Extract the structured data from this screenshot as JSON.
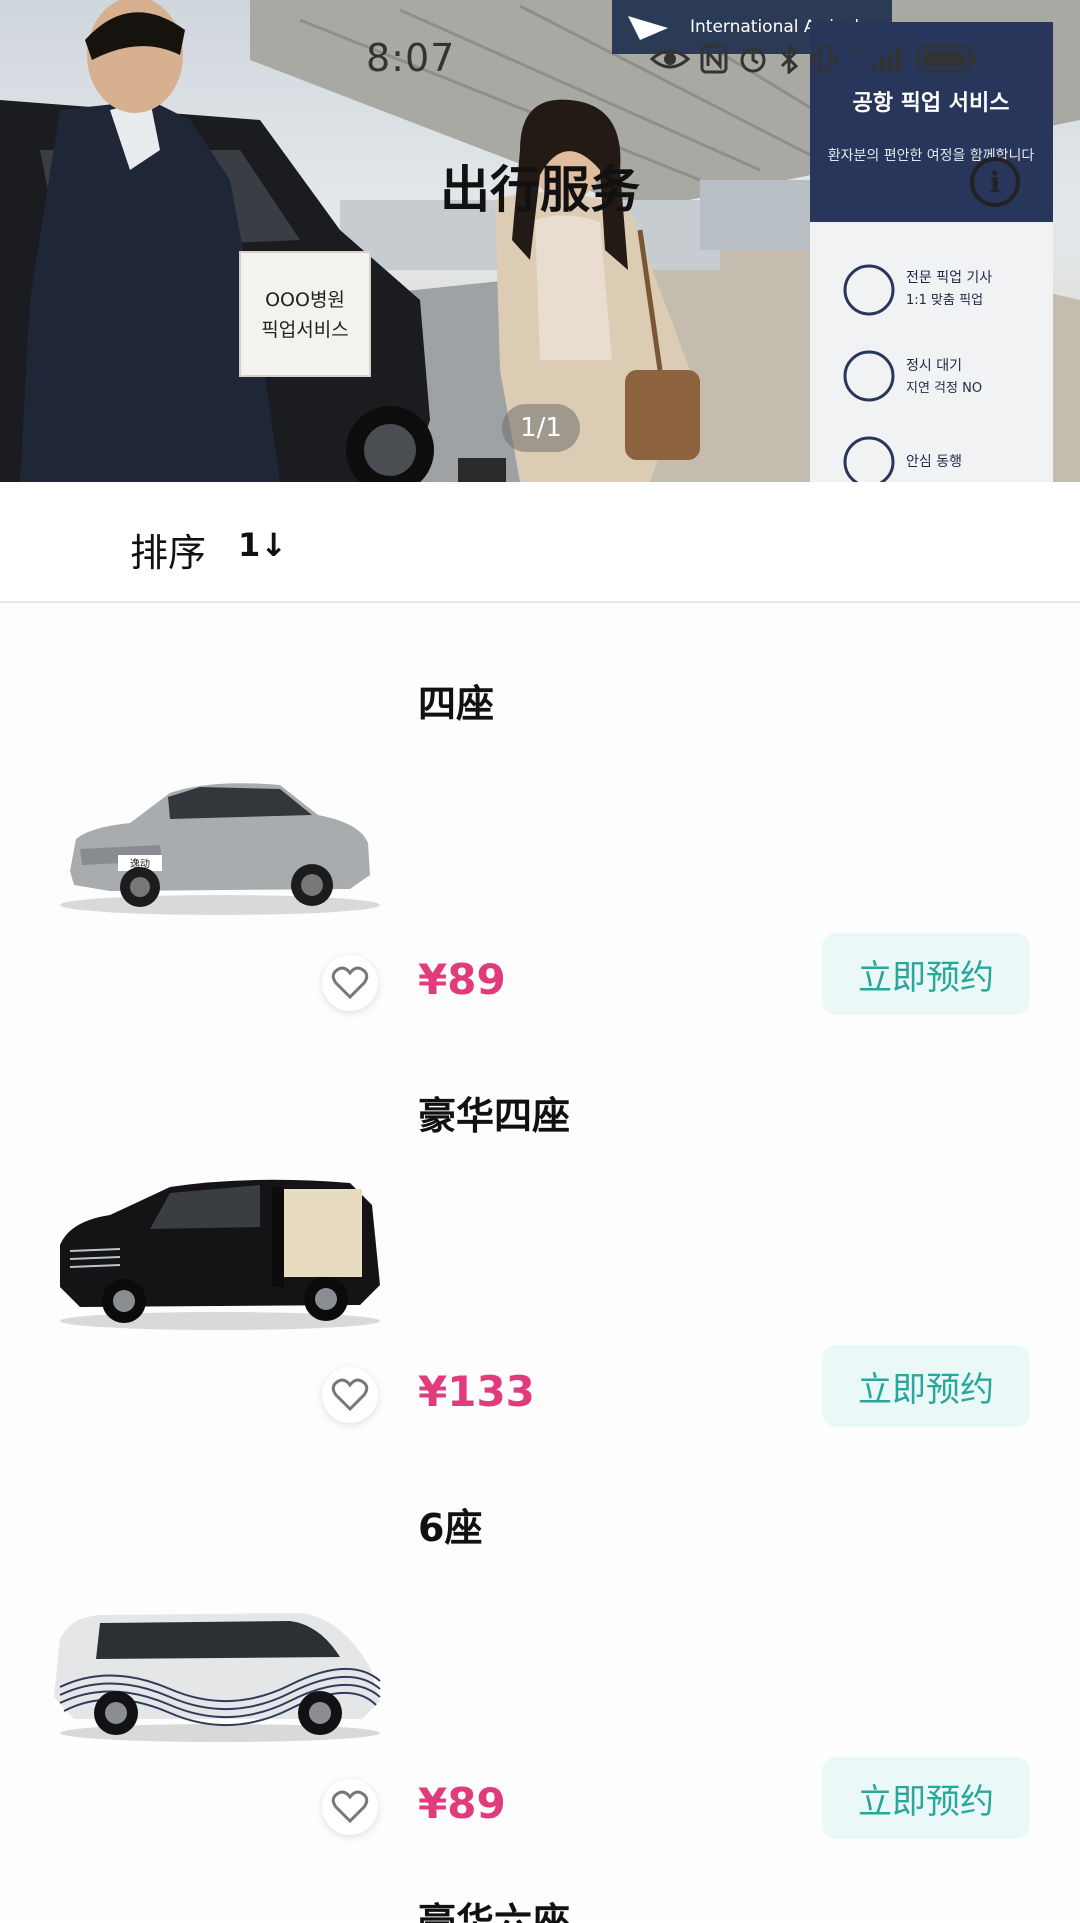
{
  "status_bar": {
    "time": "8:07",
    "icons": [
      "eye-icon",
      "nfc-icon",
      "alarm-icon",
      "bluetooth-icon",
      "vibrate-icon",
      "signal-5g-icon",
      "battery-icon"
    ]
  },
  "hero": {
    "title": "出行服务",
    "pager": "1/1",
    "photo_signs": {
      "arrivals": "International Arrivals",
      "board_title": "공항 픽업 서비스",
      "board_sub": "환자분의 편안한 여정을 함께합니다",
      "board_items": [
        "전문 픽업 기사",
        "1:1 맞춤 픽업",
        "정시 대기",
        "지연 걱정 NO",
        "안심 동행"
      ],
      "hand_sign_line1": "OOO병원",
      "hand_sign_line2": "픽업서비스"
    }
  },
  "sort": {
    "label": "排序",
    "icon_text": "1↓"
  },
  "cars": [
    {
      "title": "四座",
      "price": "¥89",
      "button": "立即预约",
      "plate": "逸动"
    },
    {
      "title": "豪华四座",
      "price": "¥133",
      "button": "立即预约"
    },
    {
      "title": "6座",
      "price": "¥89",
      "button": "立即预约"
    }
  ],
  "next_card_title": "豪华六座",
  "colors": {
    "price": "#e23b7d",
    "button_text": "#2aa79b",
    "button_bg": "#eaf8f7"
  }
}
